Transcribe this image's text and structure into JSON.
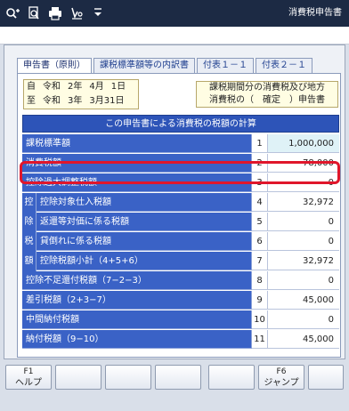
{
  "app": {
    "title": "消費税申告書"
  },
  "toolbar": {
    "icons": [
      "search-plus-icon",
      "search-file-icon",
      "printer-icon",
      "sign-check-icon",
      "dropdown-chevron-icon"
    ]
  },
  "tabs": [
    {
      "label": "申告書（原則）",
      "active": true
    },
    {
      "label": "課税標準額等の内訳書",
      "active": false
    },
    {
      "label": "付表１－１",
      "active": false
    },
    {
      "label": "付表２－１",
      "active": false
    }
  ],
  "period": {
    "from_label": "自",
    "from_era": "令和",
    "from_year": "2年",
    "from_month": "4月",
    "from_day": "1日",
    "to_label": "至",
    "to_era": "令和",
    "to_year": "3年",
    "to_month": "3月31日"
  },
  "info": {
    "line1": "課税期間分の消費税及び地方",
    "line2": "消費税の（　確定　）申告書"
  },
  "table": {
    "header": "この申告書による消費税の税額の計算",
    "side_chars": [
      "控",
      "除",
      "税",
      "額"
    ],
    "rows": [
      {
        "label": "課税標準額",
        "num": "1",
        "value": "1,000,000"
      },
      {
        "label": "消費税額",
        "num": "2",
        "value": "78,000"
      },
      {
        "label": "控除過大調整税額",
        "num": "3",
        "value": "0"
      },
      {
        "label": "控除対象仕入税額",
        "num": "4",
        "value": "32,972"
      },
      {
        "label": "返還等対価に係る税額",
        "num": "5",
        "value": "0"
      },
      {
        "label": "貸倒れに係る税額",
        "num": "6",
        "value": "0"
      },
      {
        "label": "控除税額小計（4+5+6）",
        "num": "7",
        "value": "32,972"
      },
      {
        "label": "控除不足還付税額（7−2−3）",
        "num": "8",
        "value": "0"
      },
      {
        "label": "差引税額（2+3−7）",
        "num": "9",
        "value": "45,000"
      },
      {
        "label": "中間納付税額",
        "num": "10",
        "value": "0"
      },
      {
        "label": "納付税額（9−10）",
        "num": "11",
        "value": "45,000"
      }
    ]
  },
  "fkeys": [
    {
      "key": "F1",
      "label": "ヘルプ"
    },
    {
      "key": "",
      "label": ""
    },
    {
      "key": "",
      "label": ""
    },
    {
      "key": "",
      "label": ""
    },
    {
      "key": "",
      "label": ""
    },
    {
      "key": "F6",
      "label": "ジャンプ"
    },
    {
      "key": "",
      "label": ""
    }
  ]
}
